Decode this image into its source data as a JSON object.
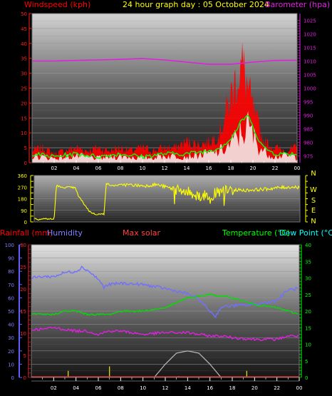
{
  "header": {
    "windspeed_label": "Windspeed (kph)",
    "title": "24 hour graph day : 05 October 2024",
    "barometer_label": "Barometer (hpa)"
  },
  "legend2": {
    "rainfall": "Rainfall (mm)",
    "humidity": "Humidity",
    "max_solar": "Max solar",
    "temperature": "Temperature (°C)",
    "dew_point": "Dew Point (°C)"
  },
  "colors": {
    "wind": "#ff0000",
    "baro": "#e020e0",
    "gust_avg": "#00ff00",
    "wind_dir": "#ffff00",
    "humidity": "#7070ff",
    "temperature": "#00dd00",
    "dew_point": "#e020e0",
    "solar": "#bbbbbb",
    "rain_axis": "#ff0000",
    "hum_axis": "#6060ff"
  },
  "chart_data": [
    {
      "type": "line",
      "name": "wind_baro",
      "x_ticks": [
        "02",
        "04",
        "06",
        "08",
        "10",
        "12",
        "14",
        "16",
        "18",
        "20",
        "22",
        "00"
      ],
      "left_axis": {
        "label": "Windspeed (kph)",
        "ticks": [
          0,
          5,
          10,
          15,
          20,
          25,
          30,
          35,
          40,
          45,
          50
        ],
        "ylim": [
          0,
          50
        ]
      },
      "right_axis": {
        "label": "Barometer (hpa)",
        "ticks": [
          975,
          980,
          985,
          990,
          995,
          1000,
          1005,
          1010,
          1015,
          1020,
          1025
        ],
        "ylim": [
          972.5,
          1027.5
        ]
      },
      "series": [
        {
          "name": "Windspeed",
          "color": "#ff0000",
          "x": [
            0,
            1,
            2,
            3,
            4,
            5,
            6,
            7,
            8,
            9,
            10,
            11,
            12,
            13,
            14,
            15,
            16,
            17,
            17.5,
            18,
            18.5,
            19,
            19.3,
            19.6,
            20,
            20.5,
            21,
            22,
            23,
            24
          ],
          "values": [
            4,
            5,
            3,
            4,
            5,
            4,
            5,
            4,
            5,
            4,
            5,
            4,
            5,
            5,
            7,
            6,
            7,
            10,
            16,
            22,
            28,
            33,
            29,
            24,
            18,
            12,
            7,
            5,
            4,
            5
          ]
        },
        {
          "name": "Gust average",
          "color": "#00ff00",
          "x": [
            0,
            2,
            4,
            6,
            8,
            10,
            12,
            14,
            16,
            17,
            18,
            18.5,
            19,
            19.5,
            20,
            20.5,
            21,
            22,
            23,
            24
          ],
          "values": [
            3,
            2,
            3,
            2,
            3,
            2,
            3,
            3,
            4,
            5,
            8,
            11,
            14,
            16,
            12,
            8,
            5,
            3,
            3,
            3
          ]
        },
        {
          "name": "Barometer",
          "color": "#e020e0",
          "x": [
            0,
            2,
            4,
            6,
            8,
            10,
            12,
            14,
            16,
            18,
            20,
            22,
            24
          ],
          "values": [
            1010,
            1010,
            1010.2,
            1010.4,
            1010.6,
            1010.9,
            1010.4,
            1009.6,
            1008.8,
            1008.8,
            1009.6,
            1010.2,
            1010.3
          ]
        }
      ]
    },
    {
      "type": "scatter",
      "name": "wind_direction",
      "x_ticks": [
        "02",
        "04",
        "06",
        "08",
        "10",
        "12",
        "14",
        "16",
        "18",
        "20",
        "22",
        "00"
      ],
      "left_axis": {
        "ticks": [
          0,
          90,
          180,
          270,
          360
        ],
        "ylim": [
          0,
          360
        ]
      },
      "right_axis": {
        "ticks": [
          "N",
          "W",
          "S",
          "E",
          "N"
        ]
      },
      "series": [
        {
          "name": "Direction",
          "color": "#ffff00",
          "x": [
            0,
            0.3,
            1,
            1.8,
            2,
            2.5,
            3,
            3.7,
            4,
            5,
            5.5,
            6.3,
            6.5,
            7,
            8,
            9,
            10,
            11,
            12,
            13,
            14,
            15,
            16,
            17,
            18,
            19,
            20,
            21,
            22,
            23,
            24
          ],
          "values": [
            30,
            20,
            25,
            20,
            285,
            265,
            270,
            265,
            200,
            80,
            60,
            60,
            300,
            280,
            290,
            285,
            280,
            290,
            270,
            240,
            230,
            200,
            210,
            235,
            250,
            245,
            250,
            255,
            265,
            270,
            270
          ]
        }
      ]
    },
    {
      "type": "line",
      "name": "temp_hum",
      "x_ticks": [
        "02",
        "04",
        "06",
        "08",
        "10",
        "12",
        "14",
        "16",
        "18",
        "20",
        "22",
        "00"
      ],
      "left_axes": [
        {
          "label": "Rainfall (mm)",
          "ticks": [
            0,
            5,
            10,
            15,
            20,
            25,
            30
          ],
          "ylim": [
            0,
            30
          ]
        },
        {
          "label": "Humidity",
          "ticks": [
            0,
            10,
            20,
            30,
            40,
            50,
            60,
            70,
            80,
            90,
            100
          ],
          "ylim": [
            0,
            100
          ]
        }
      ],
      "right_axis": {
        "label": "Temperature (°C)",
        "ticks": [
          0,
          5,
          10,
          15,
          20,
          25,
          30,
          35,
          40
        ],
        "ylim": [
          0,
          40
        ]
      },
      "series": [
        {
          "name": "Humidity",
          "color": "#7070ff",
          "x": [
            0,
            1,
            2,
            3,
            4,
            4.5,
            5,
            6,
            6.5,
            7,
            8,
            10,
            12,
            14,
            15,
            16,
            16.5,
            17,
            18,
            20,
            22,
            23,
            24
          ],
          "values": [
            75,
            76,
            76,
            79,
            80,
            83,
            81,
            74,
            68,
            70,
            71,
            70,
            67,
            63,
            59,
            50,
            46,
            53,
            54,
            55,
            58,
            66,
            67
          ]
        },
        {
          "name": "Temperature",
          "color": "#00dd00",
          "x": [
            0,
            1,
            2,
            3,
            4,
            5,
            6,
            7,
            8,
            10,
            12,
            14,
            16,
            18,
            20,
            22,
            23,
            24
          ],
          "values": [
            19,
            19,
            19,
            20,
            20,
            19,
            19,
            19,
            20,
            20,
            21,
            24,
            25,
            24,
            22,
            21,
            20,
            19
          ]
        },
        {
          "name": "Dew point",
          "color": "#e020e0",
          "x": [
            0,
            1,
            2,
            3,
            4,
            5,
            6,
            7,
            8,
            10,
            12,
            14,
            16,
            17,
            18,
            20,
            22,
            23,
            24
          ],
          "values": [
            14.5,
            14.5,
            15,
            14.5,
            14,
            14,
            13,
            14,
            14,
            13,
            13.5,
            13.5,
            12.5,
            12.5,
            12,
            11.5,
            11.5,
            12.5,
            12.5
          ]
        },
        {
          "name": "Max solar",
          "color": "#bbbbbb",
          "x": [
            11,
            12,
            13,
            14,
            15,
            16,
            17
          ],
          "values": [
            0,
            3,
            5.5,
            6,
            5.5,
            3,
            0
          ]
        },
        {
          "name": "Rain events",
          "color": "#dddd00",
          "x": [
            3.3,
            7,
            13.2,
            19.3
          ],
          "values": [
            1.5,
            2.5,
            0.3,
            1.5
          ]
        }
      ]
    }
  ]
}
